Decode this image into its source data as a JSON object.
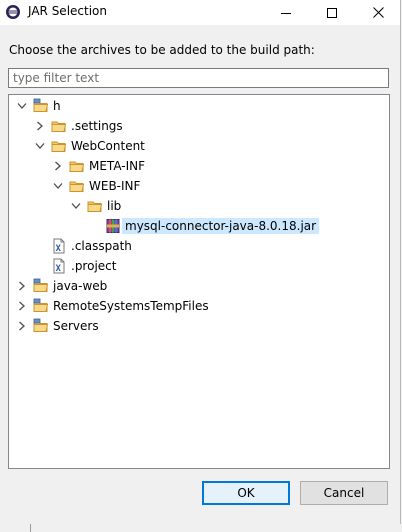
{
  "window": {
    "title": "JAR Selection"
  },
  "prompt": "Choose the archives to be added to the build path:",
  "filter": {
    "placeholder": "type filter text",
    "value": ""
  },
  "tree": [
    {
      "label": "h",
      "icon": "project-folder-icon",
      "expanded": true,
      "depth": 0,
      "twisty": "expanded"
    },
    {
      "label": ".settings",
      "icon": "folder-icon",
      "depth": 1,
      "twisty": "collapsed"
    },
    {
      "label": "WebContent",
      "icon": "folder-icon",
      "depth": 1,
      "twisty": "expanded"
    },
    {
      "label": "META-INF",
      "icon": "folder-icon",
      "depth": 2,
      "twisty": "collapsed"
    },
    {
      "label": "WEB-INF",
      "icon": "folder-icon",
      "depth": 2,
      "twisty": "expanded"
    },
    {
      "label": "lib",
      "icon": "folder-icon",
      "depth": 3,
      "twisty": "expanded"
    },
    {
      "label": "mysql-connector-java-8.0.18.jar",
      "icon": "jar-icon",
      "depth": 4,
      "twisty": "none",
      "selected": true
    },
    {
      "label": ".classpath",
      "icon": "xml-file-icon",
      "depth": 1,
      "twisty": "none"
    },
    {
      "label": ".project",
      "icon": "xml-file-icon",
      "depth": 1,
      "twisty": "none"
    },
    {
      "label": "java-web",
      "icon": "project-folder-icon",
      "depth": 0,
      "twisty": "collapsed"
    },
    {
      "label": "RemoteSystemsTempFiles",
      "icon": "project-folder-icon",
      "depth": 0,
      "twisty": "collapsed"
    },
    {
      "label": "Servers",
      "icon": "project-folder-icon",
      "depth": 0,
      "twisty": "collapsed"
    }
  ],
  "buttons": {
    "ok": "OK",
    "cancel": "Cancel"
  },
  "colors": {
    "selection": "#cce8ff",
    "default_button_border": "#0078d7",
    "folder": "#e8b94a"
  }
}
